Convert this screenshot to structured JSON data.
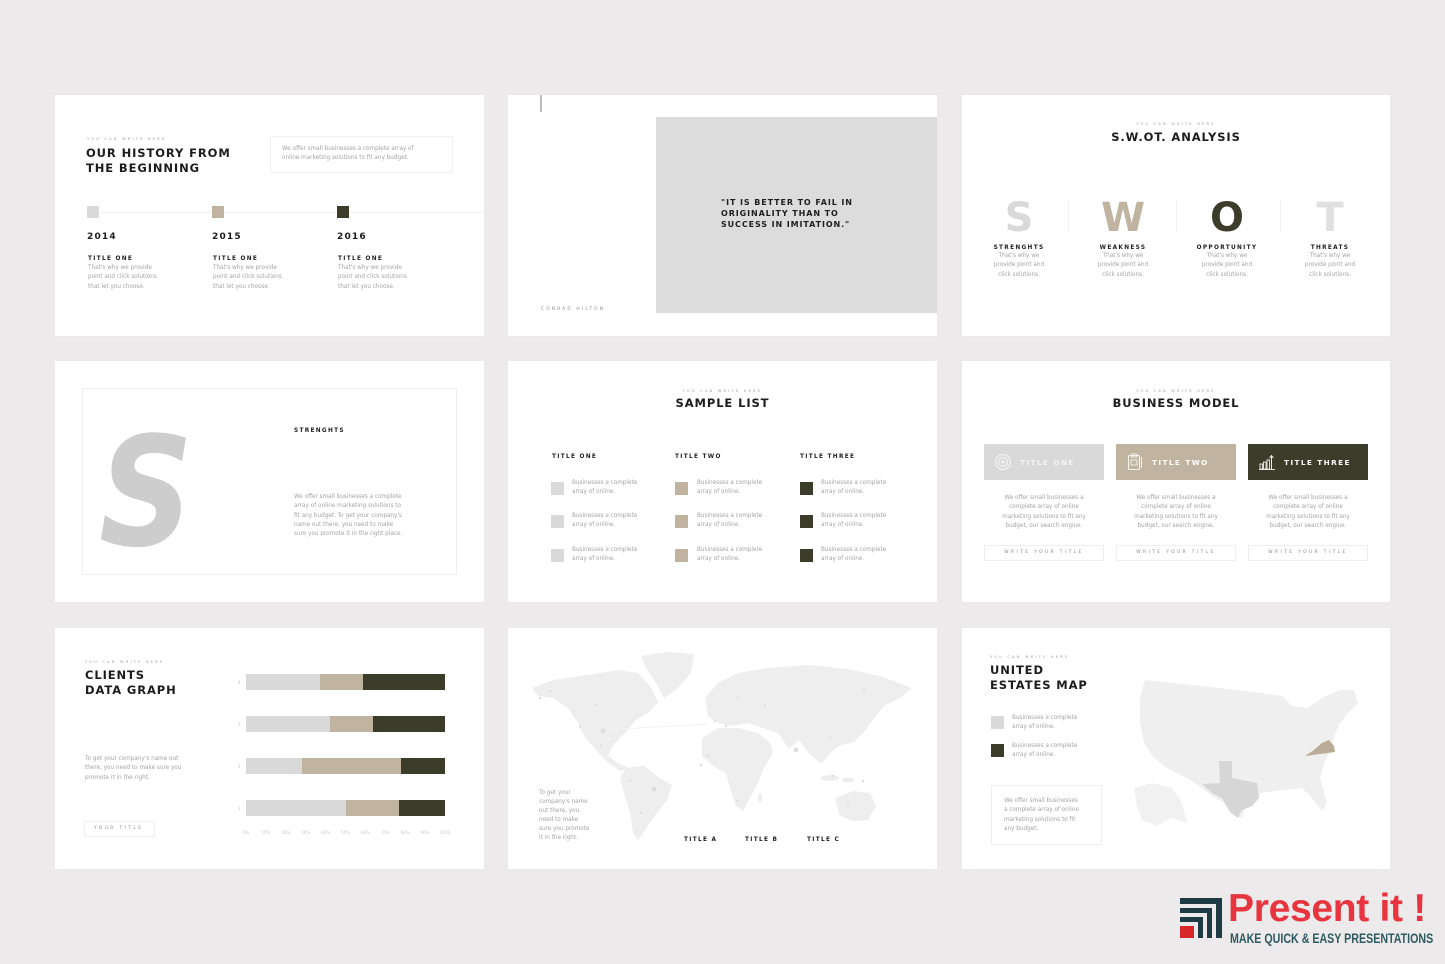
{
  "palette": {
    "page_bg": "#ECEAEA",
    "light": "#D9D9D9",
    "beige": "#C0B4A1",
    "dark": "#3C3C2A",
    "brand_red": "#E8343F",
    "brand_teal": "#2E5A62"
  },
  "branding": {
    "name": "Present it !",
    "tagline": "MAKE QUICK & EASY PRESENTATIONS"
  },
  "slides": {
    "history": {
      "eyebrow": "YOU CAN WRITE HERE",
      "title": [
        "OUR HISTORY FROM",
        "THE BEGINNING"
      ],
      "intro": "We offer small businesses a complete array of\nonline marketing solutions to fit any budget.",
      "milestones": [
        {
          "year": "2014",
          "title": "TITLE ONE",
          "text": "That's why we provide\npoint and click solutions\nthat let you choose."
        },
        {
          "year": "2015",
          "title": "TITLE ONE",
          "text": "That's why we provide\npoint and click solutions\nthat let you choose."
        },
        {
          "year": "2016",
          "title": "TITLE ONE",
          "text": "That's why we provide\npoint and click solutions\nthat let you choose."
        }
      ]
    },
    "quote": {
      "lines": [
        "\"IT IS BETTER TO FAIL IN",
        "ORIGINALITY THAN TO",
        "SUCCESS IN IMITATION.\""
      ],
      "author": "CONRAD HILTON"
    },
    "swot": {
      "eyebrow": "YOU CAN WRITE HERE",
      "title": "S.W.OT. ANALYSIS",
      "items": [
        {
          "letter": "S",
          "label": "STRENGHTS",
          "text": "That's why we\nprovide point and\nclick solutions."
        },
        {
          "letter": "W",
          "label": "WEAKNESS",
          "text": "That's why we\nprovide point and\nclick solutions."
        },
        {
          "letter": "O",
          "label": "OPPORTUNITY",
          "text": "That's why we\nprovide point and\nclick solutions."
        },
        {
          "letter": "T",
          "label": "THREATS",
          "text": "That's why we\nprovide point and\nclick solutions."
        }
      ]
    },
    "strengths": {
      "letter": "S",
      "label": "STRENGHTS",
      "text": "We offer small businesses a complete\narray of online marketing solutions to\nfit any budget. To get your company's\nname out there, you need to make\nsure you promote it in the right place."
    },
    "sample_list": {
      "eyebrow": "YOU CAN WRITE HERE",
      "title": "SAMPLE LIST",
      "columns": [
        {
          "title": "TITLE ONE",
          "items": [
            "Businesses a complete\narray of online.",
            "Businesses a complete\narray of online.",
            "Businesses a complete\narray of online."
          ]
        },
        {
          "title": "TITLE TWO",
          "items": [
            "Businesses a complete\narray of online.",
            "Businesses a complete\narray of online.",
            "Businesses a complete\narray of online."
          ]
        },
        {
          "title": "TITLE THREE",
          "items": [
            "Businesses a complete\narray of online.",
            "Businesses a complete\narray of online.",
            "Businesses a complete\narray of online."
          ]
        }
      ]
    },
    "business_model": {
      "eyebrow": "YOU CAN WRITE HERE",
      "title": "BUSINESS MODEL",
      "cards": [
        {
          "title": "TITLE ONE",
          "icon": "target-icon",
          "text": "We offer small businesses a\ncomplete array of online\nmarketing solutions to fit any\nbudget, our search engine.",
          "button": "WRITE YOUR TITLE"
        },
        {
          "title": "TITLE TWO",
          "icon": "clipboard-icon",
          "text": "We offer small businesses a\ncomplete array of online\nmarketing solutions to fit any\nbudget, our search engine.",
          "button": "WRITE YOUR TITLE"
        },
        {
          "title": "TITLE THREE",
          "icon": "growth-chart-icon",
          "text": "We offer small businesses a\ncomplete array of online\nmarketing solutions to fit any\nbudget, our search engine.",
          "button": "WRITE YOUR TITLE"
        }
      ]
    },
    "clients": {
      "eyebrow": "YOU CAN WRITE HERE",
      "title": [
        "CLIENTS",
        "DATA GRAPH"
      ],
      "text": "To get your company's name out\nthere, you need to make sure you\npromote it in the right.",
      "button": "YOUR TITLE"
    },
    "world_map": {
      "text": "To get your\ncompany's name\nout there, you\nneed to make\nsure you promote\nit in the right.",
      "titles": [
        "TITLE A",
        "TITLE B",
        "TITLE C"
      ]
    },
    "us_map": {
      "eyebrow": "YOU CAN WRITE HERE",
      "title": [
        "UNITED",
        "ESTATES MAP"
      ],
      "legend": [
        {
          "text": "Businesses a complete\narray of online."
        },
        {
          "text": "Businesses a complete\narray of online."
        }
      ],
      "text": "We offer small businesses\na complete array of online\nmarketing solutions to fit\nany budget."
    }
  },
  "chart_data": {
    "type": "bar",
    "orientation": "horizontal",
    "stacked": true,
    "title": "CLIENTS DATA GRAPH",
    "categories": [
      "4",
      "3",
      "2",
      "1"
    ],
    "series": [
      {
        "color": "#D9D9D9",
        "values": [
          37,
          42,
          28,
          50
        ]
      },
      {
        "color": "#C0B4A1",
        "values": [
          22,
          22,
          50,
          27
        ]
      },
      {
        "color": "#3C3C2A",
        "values": [
          41,
          36,
          22,
          23
        ]
      }
    ],
    "xticks": [
      "0%",
      "10%",
      "20%",
      "30%",
      "40%",
      "50%",
      "60%",
      "70%",
      "80%",
      "90%",
      "100%"
    ],
    "xlim": [
      0,
      100
    ],
    "xlabel": "",
    "ylabel": "",
    "grid": false,
    "legend": "none"
  }
}
